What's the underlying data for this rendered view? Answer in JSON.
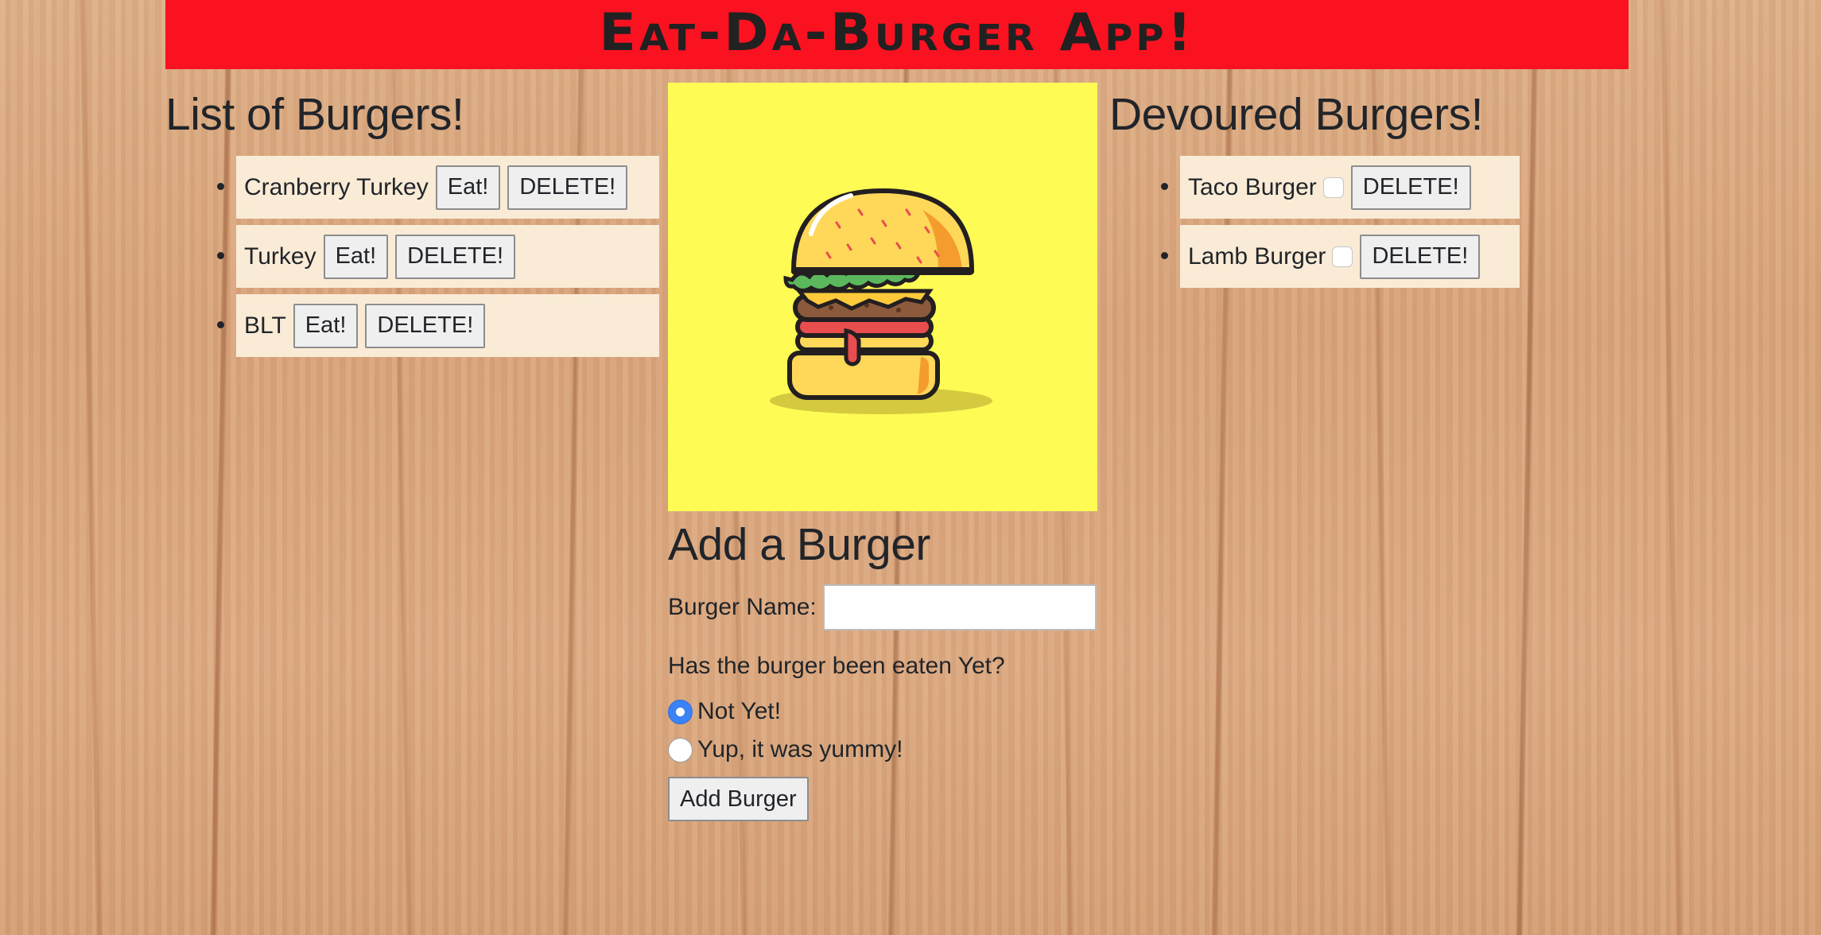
{
  "header": {
    "title": "Eat-Da-Burger App!",
    "background_color": "#fa1220"
  },
  "left_column": {
    "title": "List of Burgers!",
    "items": [
      {
        "name": "Cranberry Turkey",
        "eat_label": "Eat!",
        "delete_label": "DELETE!"
      },
      {
        "name": "Turkey",
        "eat_label": "Eat!",
        "delete_label": "DELETE!"
      },
      {
        "name": "BLT",
        "eat_label": "Eat!",
        "delete_label": "DELETE!"
      }
    ]
  },
  "right_column": {
    "title": "Devoured Burgers!",
    "items": [
      {
        "name": "Taco Burger",
        "delete_label": "DELETE!"
      },
      {
        "name": "Lamb Burger",
        "delete_label": "DELETE!"
      }
    ]
  },
  "center": {
    "image": "burger-icon",
    "image_background": "#fefb55",
    "form": {
      "title": "Add a Burger",
      "name_label": "Burger Name:",
      "name_value": "",
      "question": "Has the burger been eaten Yet?",
      "options": [
        {
          "label": "Not Yet!",
          "checked": true
        },
        {
          "label": "Yup, it was yummy!",
          "checked": false
        }
      ],
      "submit_label": "Add Burger"
    }
  }
}
